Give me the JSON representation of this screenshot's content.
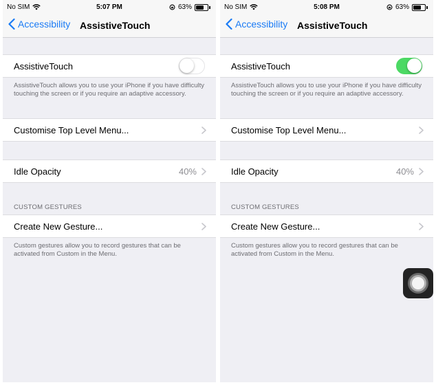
{
  "colors": {
    "accent": "#1a7bf5",
    "toggle_on": "#4cd964",
    "grouped_background": "#efeff4",
    "secondary_text": "#6d6d72"
  },
  "screens": [
    {
      "status": {
        "carrier": "No SIM",
        "time": "5:07 PM",
        "battery": "63%"
      },
      "nav": {
        "back_label": "Accessibility",
        "title": "AssistiveTouch"
      },
      "assistive_touch": {
        "label": "AssistiveTouch",
        "enabled": false,
        "description": "AssistiveTouch allows you to use your iPhone if you have difficulty touching the screen or if you require an adaptive accessory."
      },
      "customise_menu": {
        "label": "Customise Top Level Menu..."
      },
      "idle_opacity": {
        "label": "Idle Opacity",
        "value": "40%"
      },
      "custom_gestures": {
        "header": "CUSTOM GESTURES",
        "create_label": "Create New Gesture...",
        "description": "Custom gestures allow you to record gestures that can be activated from Custom in the Menu."
      }
    },
    {
      "status": {
        "carrier": "No SIM",
        "time": "5:08 PM",
        "battery": "63%"
      },
      "nav": {
        "back_label": "Accessibility",
        "title": "AssistiveTouch"
      },
      "assistive_touch": {
        "label": "AssistiveTouch",
        "enabled": true,
        "description": "AssistiveTouch allows you to use your iPhone if you have difficulty touching the screen or if you require an adaptive accessory."
      },
      "customise_menu": {
        "label": "Customise Top Level Menu..."
      },
      "idle_opacity": {
        "label": "Idle Opacity",
        "value": "40%"
      },
      "custom_gestures": {
        "header": "CUSTOM GESTURES",
        "create_label": "Create New Gesture...",
        "description": "Custom gestures allow you to record gestures that can be activated from Custom in the Menu."
      }
    }
  ],
  "icons": {
    "signal": "wifi-icon",
    "orientation_lock": "orientation-lock-icon",
    "battery": "battery-icon",
    "back": "chevron-left-icon",
    "disclosure": "chevron-right-icon",
    "floating_button": "assistive-touch-icon"
  }
}
